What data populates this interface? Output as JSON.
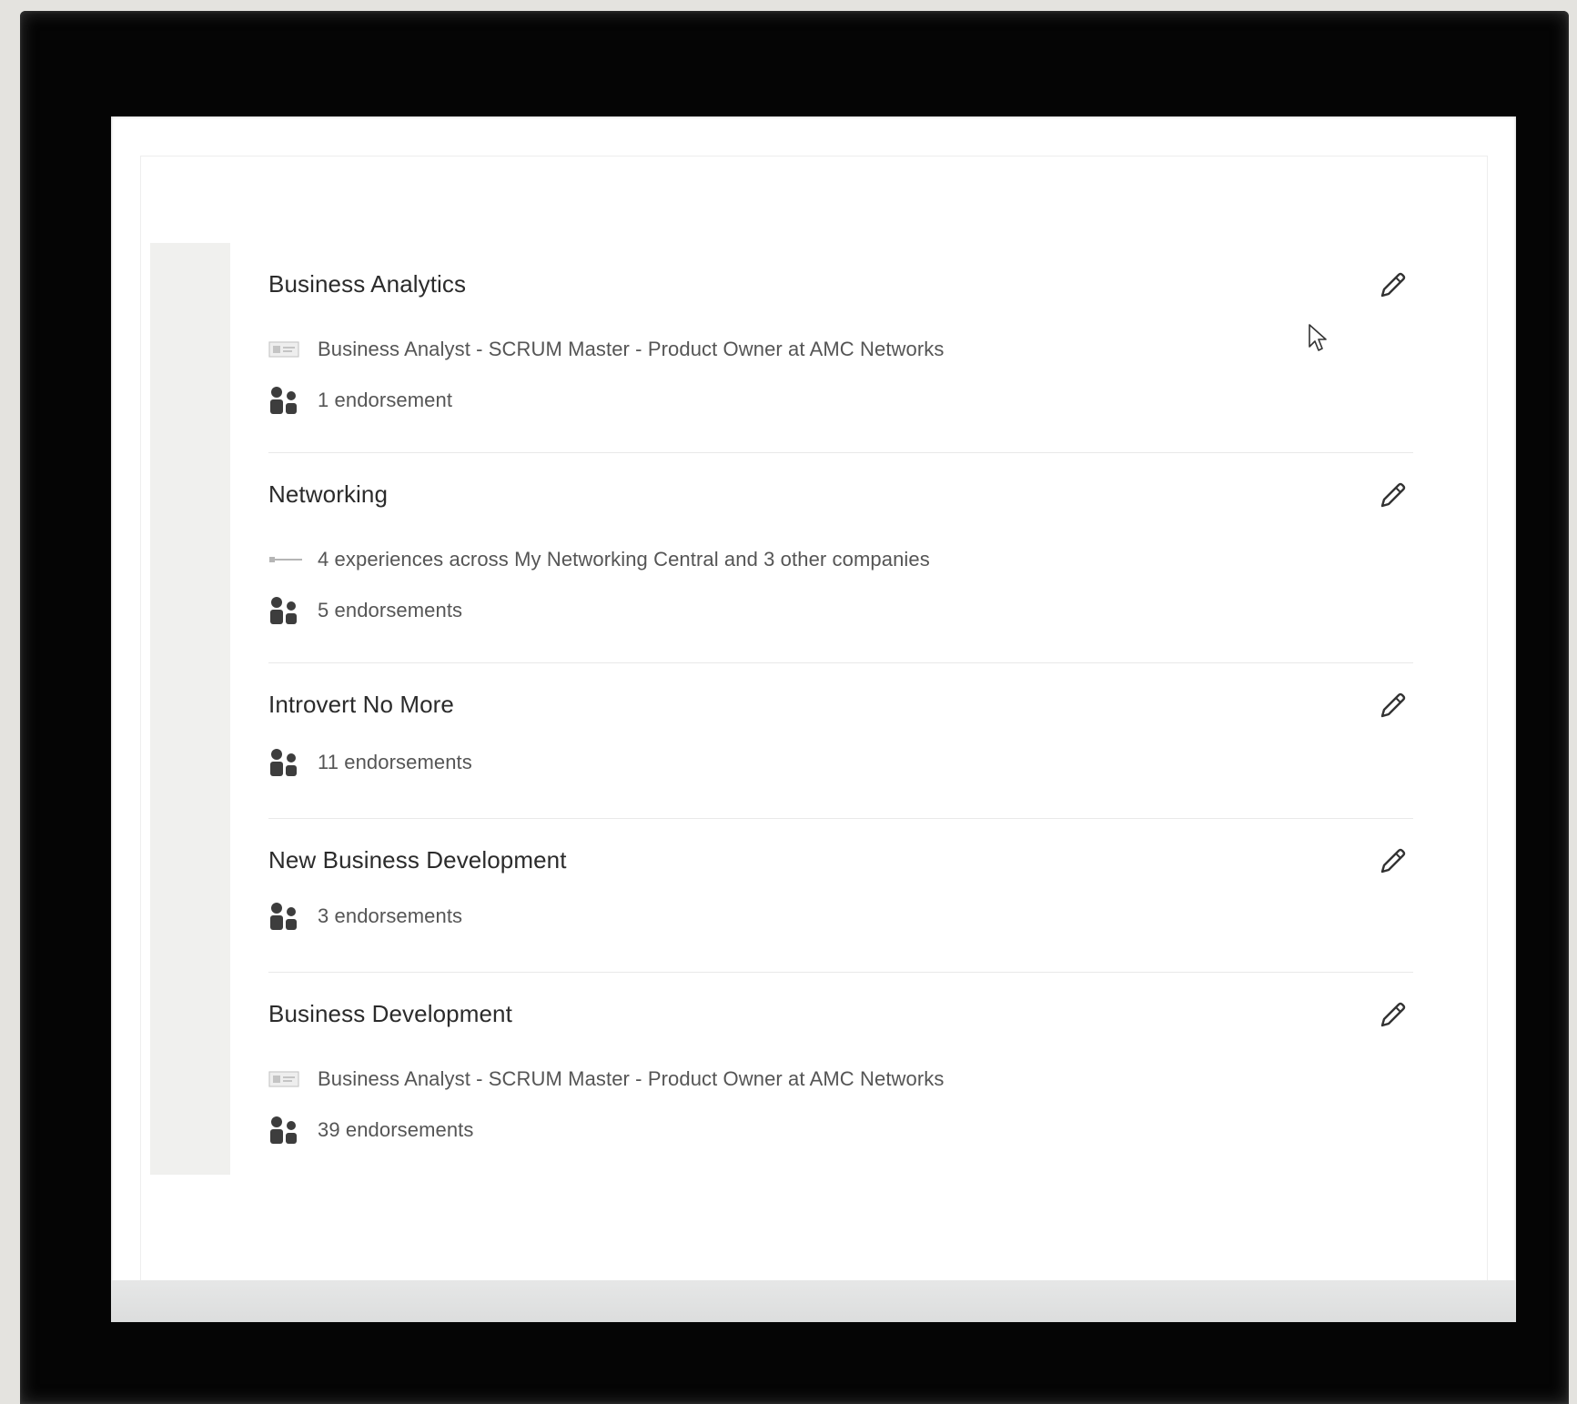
{
  "skills": [
    {
      "name": "Business Analytics",
      "experience": "Business Analyst - SCRUM Master - Product Owner at AMC Networks",
      "experience_icon": "company-logo-icon",
      "endorsements": "1 endorsement",
      "edit_icon": "pencil-icon"
    },
    {
      "name": "Networking",
      "experience": "4 experiences across My Networking Central and 3 other companies",
      "experience_icon": "experiences-icon",
      "endorsements": "5 endorsements",
      "edit_icon": "pencil-icon"
    },
    {
      "name": "Introvert No More",
      "endorsements": "11 endorsements",
      "edit_icon": "pencil-icon"
    },
    {
      "name": "New Business Development",
      "endorsements": "3 endorsements",
      "edit_icon": "pencil-icon"
    },
    {
      "name": "Business Development",
      "experience": "Business Analyst - SCRUM Master - Product Owner at AMC Networks",
      "experience_icon": "company-logo-icon",
      "endorsements": "39 endorsements",
      "edit_icon": "pencil-icon"
    }
  ],
  "colors": {
    "frame": "#050505",
    "page_bg": "#e4e3df",
    "side_strip": "#f0f0ee",
    "skill_name": "#2b2b2b",
    "detail_text": "#555555"
  }
}
